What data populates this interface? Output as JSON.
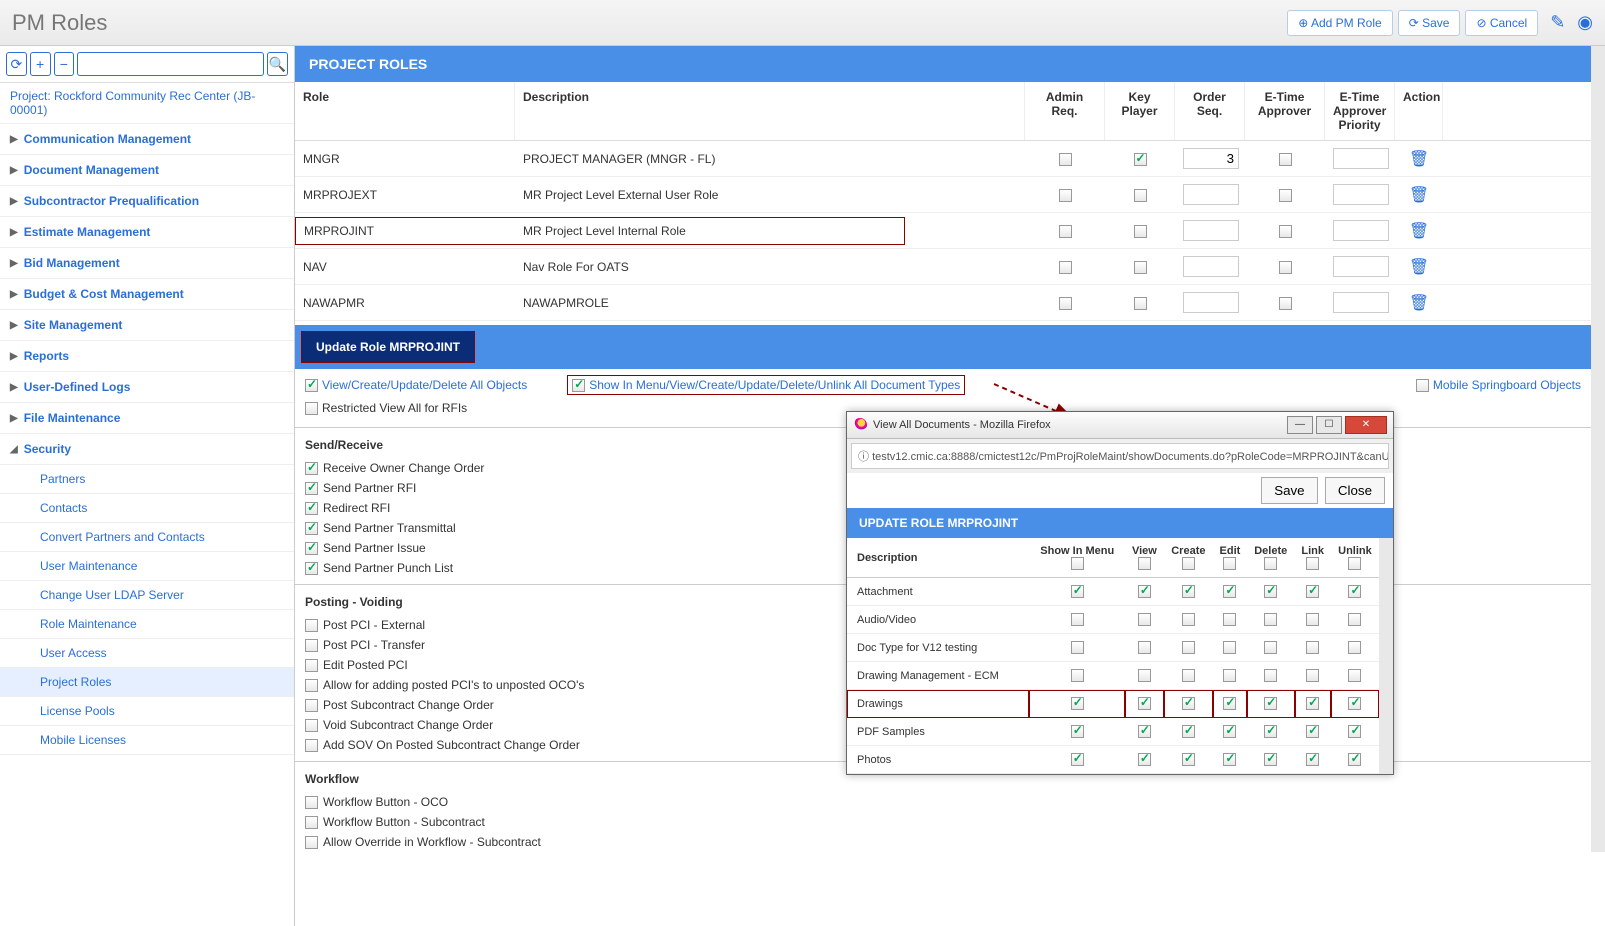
{
  "page_title": "PM Roles",
  "toolbar": {
    "add": "Add PM Role",
    "save": "Save",
    "cancel": "Cancel"
  },
  "project_label": "Project: Rockford Community Rec Center (JB-00001)",
  "tree": [
    {
      "label": "Communication Management",
      "open": false
    },
    {
      "label": "Document Management",
      "open": false
    },
    {
      "label": "Subcontractor Prequalification",
      "open": false
    },
    {
      "label": "Estimate Management",
      "open": false
    },
    {
      "label": "Bid Management",
      "open": false
    },
    {
      "label": "Budget & Cost Management",
      "open": false
    },
    {
      "label": "Site Management",
      "open": false
    },
    {
      "label": "Reports",
      "open": false
    },
    {
      "label": "User-Defined Logs",
      "open": false
    },
    {
      "label": "File Maintenance",
      "open": false
    },
    {
      "label": "Security",
      "open": true,
      "children": [
        "Partners",
        "Contacts",
        "Convert Partners and Contacts",
        "User Maintenance",
        "Change User LDAP Server",
        "Role Maintenance",
        "User Access",
        "Project Roles",
        "License Pools",
        "Mobile Licenses"
      ],
      "active": "Project Roles"
    }
  ],
  "grid": {
    "title": "PROJECT ROLES",
    "headers": [
      "Role",
      "Description",
      "Admin Req.",
      "Key Player",
      "Order Seq.",
      "E-Time Approver",
      "E-Time Approver Priority",
      "Action"
    ],
    "rows": [
      {
        "role": "MNGR",
        "desc": "PROJECT MANAGER (MNGR - FL)",
        "adm": false,
        "key": true,
        "seq": "3",
        "eta": false,
        "etp": ""
      },
      {
        "role": "MRPROJEXT",
        "desc": "MR Project Level External User Role",
        "adm": false,
        "key": false,
        "seq": "",
        "eta": false,
        "etp": ""
      },
      {
        "role": "MRPROJINT",
        "desc": "MR Project Level Internal Role",
        "adm": false,
        "key": false,
        "seq": "",
        "eta": false,
        "etp": "",
        "hl": true
      },
      {
        "role": "NAV",
        "desc": "Nav Role For OATS",
        "adm": false,
        "key": false,
        "seq": "",
        "eta": false,
        "etp": ""
      },
      {
        "role": "NAWAPMR",
        "desc": "NAWAPMROLE",
        "adm": false,
        "key": false,
        "seq": "",
        "eta": false,
        "etp": ""
      }
    ]
  },
  "update_bar": "Update Role MRPROJINT",
  "opts": {
    "all_obj": "View/Create/Update/Delete All Objects",
    "restricted": "Restricted View All for RFIs",
    "show_menu": "Show In Menu/View/Create/Update/Delete/Unlink All Document Types",
    "mobile": "Mobile Springboard Objects"
  },
  "sections": {
    "send_receive": {
      "title": "Send/Receive",
      "items": [
        {
          "label": "Receive Owner Change Order",
          "checked": true
        },
        {
          "label": "Send Partner RFI",
          "checked": true
        },
        {
          "label": "Redirect RFI",
          "checked": true
        },
        {
          "label": "Send Partner Transmittal",
          "checked": true
        },
        {
          "label": "Send Partner Issue",
          "checked": true
        },
        {
          "label": "Send Partner Punch List",
          "checked": true
        }
      ]
    },
    "posting": {
      "title": "Posting - Voiding",
      "items": [
        {
          "label": "Post PCI - External",
          "checked": false
        },
        {
          "label": "Post PCI - Transfer",
          "checked": false
        },
        {
          "label": "Edit Posted PCI",
          "checked": false
        },
        {
          "label": "Allow for adding posted PCI's to unposted OCO's",
          "checked": false
        },
        {
          "label": "Post Subcontract Change Order",
          "checked": false
        },
        {
          "label": "Void Subcontract Change Order",
          "checked": false
        },
        {
          "label": "Add SOV On Posted Subcontract Change Order",
          "checked": false
        }
      ]
    },
    "workflow": {
      "title": "Workflow",
      "items": [
        {
          "label": "Workflow Button - OCO",
          "checked": false
        },
        {
          "label": "Workflow Button - Subcontract",
          "checked": false
        },
        {
          "label": "Allow Override in Workflow - Subcontract",
          "checked": false
        }
      ]
    }
  },
  "popup": {
    "window_title": "View All Documents - Mozilla Firefox",
    "url": "testv12.cmic.ca:8888/cmictest12c/PmProjRoleMaint/showDocuments.do?pRoleCode=MRPROJINT&canU",
    "save": "Save",
    "close": "Close",
    "header": "UPDATE ROLE MRPROJINT",
    "cols": [
      "Description",
      "Show In Menu",
      "View",
      "Create",
      "Edit",
      "Delete",
      "Link",
      "Unlink"
    ],
    "head_checks": [
      false,
      false,
      false,
      false,
      false,
      false,
      false
    ],
    "rows": [
      {
        "desc": "Attachment",
        "c": [
          true,
          true,
          true,
          true,
          true,
          true,
          true
        ]
      },
      {
        "desc": "Audio/Video",
        "c": [
          false,
          false,
          false,
          false,
          false,
          false,
          false
        ]
      },
      {
        "desc": "Doc Type for V12 testing",
        "c": [
          false,
          false,
          false,
          false,
          false,
          false,
          false
        ]
      },
      {
        "desc": "Drawing Management - ECM",
        "c": [
          false,
          false,
          false,
          false,
          false,
          false,
          false
        ]
      },
      {
        "desc": "Drawings",
        "c": [
          true,
          true,
          true,
          true,
          true,
          true,
          true
        ],
        "hl": true
      },
      {
        "desc": "PDF Samples",
        "c": [
          true,
          true,
          true,
          true,
          true,
          true,
          true
        ]
      },
      {
        "desc": "Photos",
        "c": [
          true,
          true,
          true,
          true,
          true,
          true,
          true
        ]
      }
    ]
  }
}
